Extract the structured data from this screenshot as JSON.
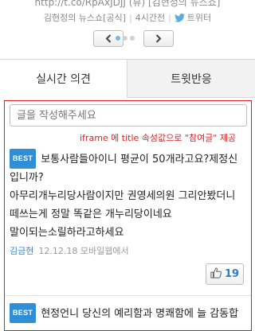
{
  "header": {
    "link_text": "http://t.co/RpAxJDJJ (뷰) [김현정의 뉴스쇼]",
    "source": "김현정의 뉴스쇼[공식]",
    "time_ago": "4시간전",
    "via": "트위터"
  },
  "pager": {
    "prev_icon": "chevron-left-icon",
    "next_icon": "chevron-right-icon",
    "page_count": 3,
    "active_page": 1
  },
  "tabs": [
    {
      "label": "실시간 의견",
      "active": true
    },
    {
      "label": "트윗반응",
      "active": false
    }
  ],
  "comment_input": {
    "placeholder": "글을 작성해주세요"
  },
  "annotation": "iframe 에 title 속성값으로 \"참여글\" 제공",
  "comments": [
    {
      "badge": "BEST",
      "lines": [
        "보통사람들아이니 평균이 50개라고요?제정신",
        "입니까?",
        "아무리개누리당사람이지만 권영세의원 그리안봤더니",
        "떼쓰는게 정말 똑같은 개누리당이네요",
        "말이되는소릴하라고하세요"
      ],
      "author": "김금현",
      "date": "12.12.18 모바일웹에서",
      "likes": "19"
    },
    {
      "badge": "BEST",
      "lines": [
        "현정언니 당신의 예리함과 명쾌함에 늘 감동합"
      ]
    }
  ],
  "colors": {
    "accent_blue": "#2f8fd6",
    "annotation_red": "#e02020"
  }
}
